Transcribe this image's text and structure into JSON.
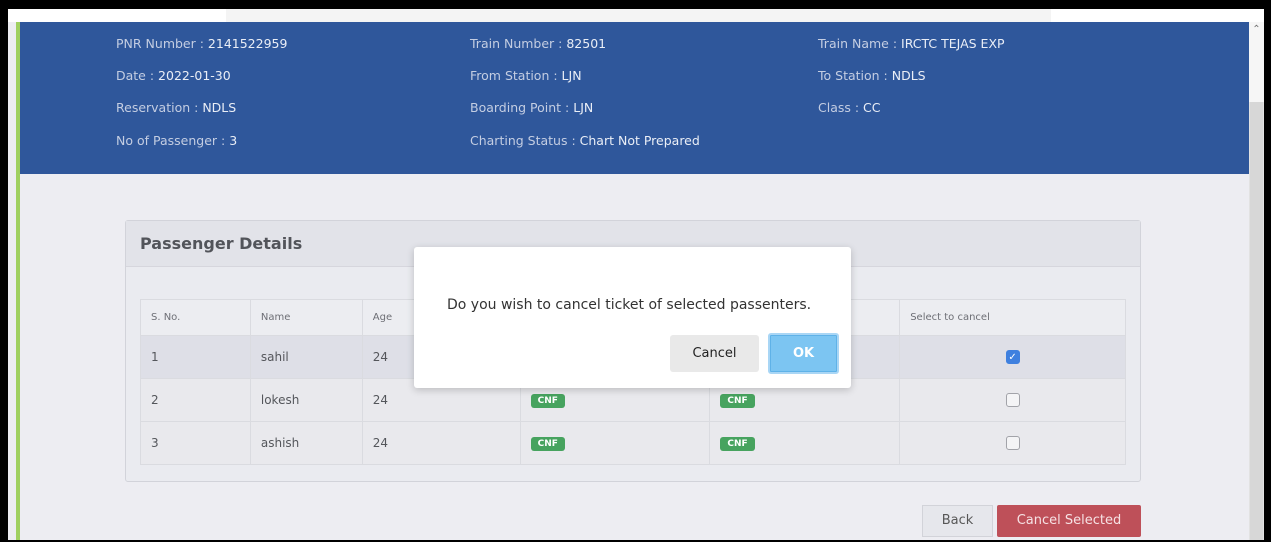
{
  "info": {
    "pnr_label": "PNR Number : ",
    "pnr_value": "2141522959",
    "train_number_label": "Train Number : ",
    "train_number_value": "82501",
    "train_name_label": "Train Name : ",
    "train_name_value": "IRCTC TEJAS EXP",
    "date_label": "Date : ",
    "date_value": "2022-01-30",
    "from_label": "From Station : ",
    "from_value": "LJN",
    "to_label": "To Station : ",
    "to_value": "NDLS",
    "reservation_label": "Reservation : ",
    "reservation_value": "NDLS",
    "boarding_label": "Boarding Point : ",
    "boarding_value": "LJN",
    "class_label": "Class : ",
    "class_value": "CC",
    "passengers_label": "No of Passenger : ",
    "passengers_value": "3",
    "charting_label": "Charting Status : ",
    "charting_value": "Chart Not Prepared"
  },
  "passenger_details": {
    "title": "Passenger Details",
    "columns": [
      "S. No.",
      "Name",
      "Age",
      "",
      "",
      "Select to cancel"
    ],
    "rows": [
      {
        "sno": "1",
        "name": "sahil",
        "age": "24",
        "booking_status": "",
        "current_status": "",
        "selected": true
      },
      {
        "sno": "2",
        "name": "lokesh",
        "age": "24",
        "booking_status": "CNF",
        "current_status": "CNF",
        "selected": false
      },
      {
        "sno": "3",
        "name": "ashish",
        "age": "24",
        "booking_status": "CNF",
        "current_status": "CNF",
        "selected": false
      }
    ]
  },
  "actions": {
    "back_label": "Back",
    "cancel_selected_label": "Cancel Selected"
  },
  "modal": {
    "message": "Do you wish to cancel ticket of selected passenters.",
    "cancel_label": "Cancel",
    "ok_label": "OK"
  },
  "colors": {
    "header_bg": "#023386",
    "accent_green": "#8cc63f",
    "badge_green": "#1f8f3c",
    "danger": "#b02a35",
    "ok_blue": "#7cc5f2"
  }
}
